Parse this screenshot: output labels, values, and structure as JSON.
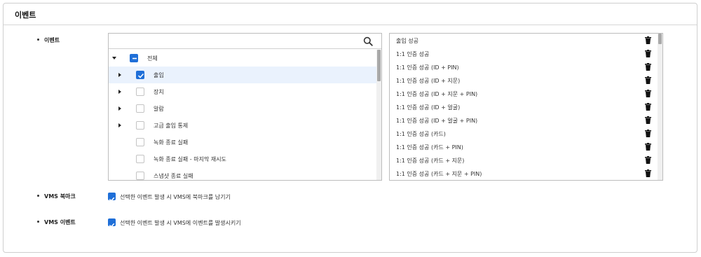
{
  "panel": {
    "title": "이벤트"
  },
  "rows": {
    "event_label": "이벤트",
    "vms_bookmark_label": "VMS 북마크",
    "vms_event_label": "VMS 이벤트"
  },
  "search": {
    "value": "",
    "placeholder": ""
  },
  "tree": {
    "root_label": "전체",
    "items": [
      {
        "label": "출입",
        "checked": true,
        "expandable": true
      },
      {
        "label": "장치",
        "checked": false,
        "expandable": true
      },
      {
        "label": "알람",
        "checked": false,
        "expandable": true
      },
      {
        "label": "고급 출입 통제",
        "checked": false,
        "expandable": true
      },
      {
        "label": "녹화 종료 실패",
        "checked": false,
        "expandable": false
      },
      {
        "label": "녹화 종료 실패 - 마지막 재시도",
        "checked": false,
        "expandable": false
      },
      {
        "label": "스냅샷 종료 실패",
        "checked": false,
        "expandable": false
      }
    ]
  },
  "selected": [
    "출입 성공",
    "1:1 인증 성공",
    "1:1 인증 성공 (ID + PIN)",
    "1:1 인증 성공 (ID + 지문)",
    "1:1 인증 성공 (ID + 지문 + PIN)",
    "1:1 인증 성공 (ID + 얼굴)",
    "1:1 인증 성공 (ID + 얼굴 + PIN)",
    "1:1 인증 성공 (카드)",
    "1:1 인증 성공 (카드 + PIN)",
    "1:1 인증 성공 (카드 + 지문)",
    "1:1 인증 성공 (카드 + 지문 + PIN)"
  ],
  "options": {
    "bookmark_text": "선택한 이벤트 발생 시 VMS에 북마크를 남기기",
    "bookmark_checked": true,
    "event_text": "선택한 이벤트 발생 시 VMS에 이벤트를 발생시키기",
    "event_checked": true
  },
  "colors": {
    "accent": "#1f6fd8",
    "selected_row": "#eaf2fd",
    "border": "#bdbdbd"
  },
  "icons": {
    "search": "search-icon",
    "delete": "trash-icon",
    "expand": "caret-right-icon",
    "collapse": "caret-down-icon"
  }
}
